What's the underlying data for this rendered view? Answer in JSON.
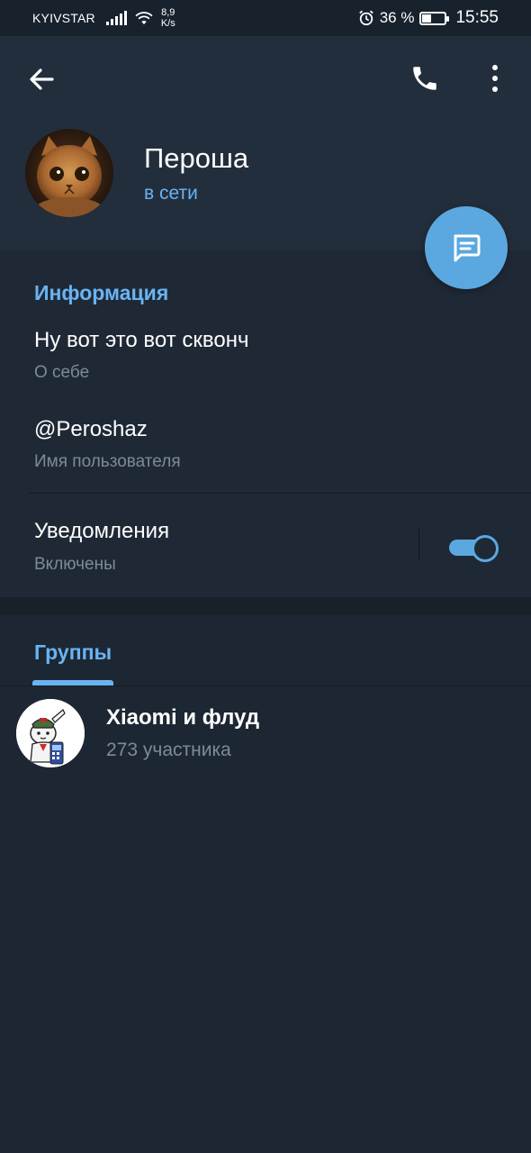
{
  "status_bar": {
    "carrier": "KYIVSTAR",
    "net_speed_value": "8,9",
    "net_speed_unit": "K/s",
    "battery_percent_text": "36 %",
    "battery_level": 0.36,
    "time": "15:55",
    "icons": [
      "signal-icon",
      "wifi-icon",
      "alarm-icon",
      "battery-icon"
    ]
  },
  "toolbar": {
    "back_icon": "arrow-left-icon",
    "call_icon": "phone-icon",
    "more_icon": "more-vertical-icon"
  },
  "profile": {
    "name": "Пероша",
    "status": "в сети"
  },
  "fab": {
    "icon": "message-icon"
  },
  "info": {
    "section_title": "Информация",
    "bio": {
      "value": "Ну вот это вот сквонч",
      "label": "О себе"
    },
    "username": {
      "value": "@Peroshaz",
      "label": "Имя пользователя"
    },
    "notifications": {
      "value": "Уведомления",
      "label": "Включены",
      "enabled": true
    }
  },
  "groups": {
    "tab_label": "Группы",
    "items": [
      {
        "name": "Xiaomi и флуд",
        "members": "273 участника"
      }
    ]
  },
  "colors": {
    "accent": "#6ab3f3",
    "fab": "#5ba8e0",
    "header_bg": "#232e3c",
    "page_bg": "#1d2733"
  }
}
